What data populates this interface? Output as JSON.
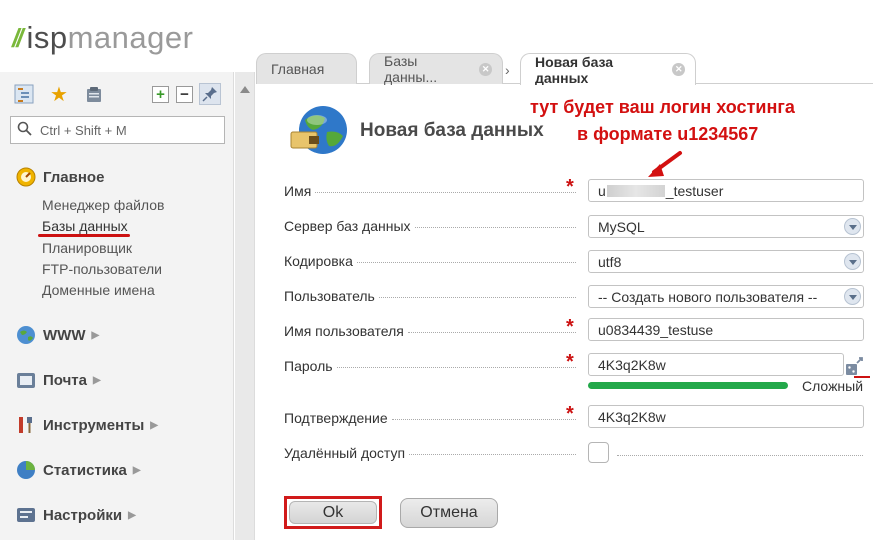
{
  "brand": {
    "mark": "//",
    "isp": "isp",
    "manager": "manager"
  },
  "sidebar": {
    "search_placeholder": "Ctrl + Shift + M",
    "sections": [
      {
        "label": "Главное",
        "icon": "dashboard-icon"
      },
      {
        "label": "WWW",
        "icon": "globe-icon"
      },
      {
        "label": "Почта",
        "icon": "mail-icon"
      },
      {
        "label": "Инструменты",
        "icon": "tools-icon"
      },
      {
        "label": "Статистика",
        "icon": "stats-icon"
      },
      {
        "label": "Настройки",
        "icon": "settings-icon"
      }
    ],
    "main_items": [
      "Менеджер файлов",
      "Базы данных",
      "Планировщик",
      "FTP-пользователи",
      "Доменные имена"
    ]
  },
  "tabs": [
    {
      "label": "Главная"
    },
    {
      "label": "Базы данны..."
    },
    {
      "label": "Новая база данных"
    }
  ],
  "page": {
    "title": "Новая база данных",
    "annotation_line1": "тут будет ваш логин хостинга",
    "annotation_line2": "в формате u1234567"
  },
  "form": {
    "name": {
      "label": "Имя",
      "value_prefix": "u",
      "value_suffix": "_testuser"
    },
    "server": {
      "label": "Сервер баз данных",
      "value": "MySQL"
    },
    "encoding": {
      "label": "Кодировка",
      "value": "utf8"
    },
    "user": {
      "label": "Пользователь",
      "value": "-- Создать нового пользователя --"
    },
    "username": {
      "label": "Имя пользователя",
      "value": "u0834439_testuse"
    },
    "password": {
      "label": "Пароль",
      "value": "4K3q2K8w",
      "strength": "Сложный",
      "strength_fraction": 1.0
    },
    "confirm": {
      "label": "Подтверждение",
      "value": "4K3q2K8w"
    },
    "remote": {
      "label": "Удалённый доступ",
      "checked": false
    }
  },
  "buttons": {
    "ok": "Ok",
    "cancel": "Отмена"
  },
  "colors": {
    "accent_red": "#d31010",
    "logo_green": "#7ab83b",
    "strength_green": "#23a84a"
  }
}
